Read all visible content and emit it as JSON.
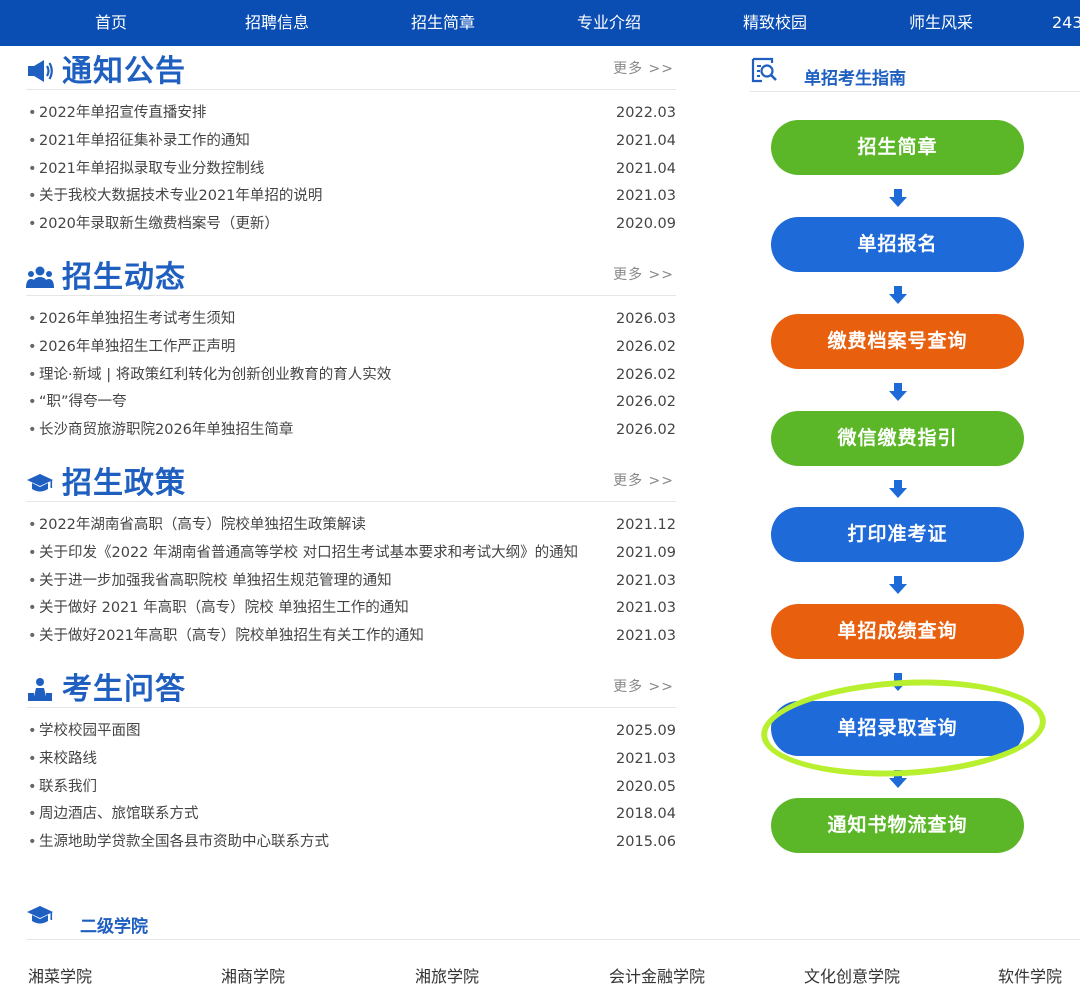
{
  "nav": [
    "首页",
    "招聘信息",
    "招生简章",
    "专业介绍",
    "精致校园",
    "师生风采",
    "243"
  ],
  "sections": [
    {
      "title": "通知公告",
      "more": "更多 >>",
      "items": [
        {
          "title": "2022年单招宣传直播安排",
          "date": "2022.03"
        },
        {
          "title": "2021年单招征集补录工作的通知",
          "date": "2021.04"
        },
        {
          "title": "2021年单招拟录取专业分数控制线",
          "date": "2021.04"
        },
        {
          "title": "关于我校大数据技术专业2021年单招的说明",
          "date": "2021.03"
        },
        {
          "title": "2020年录取新生缴费档案号（更新）",
          "date": "2020.09"
        }
      ]
    },
    {
      "title": "招生动态",
      "more": "更多 >>",
      "items": [
        {
          "title": "2026年单独招生考试考生须知",
          "date": "2026.03"
        },
        {
          "title": "2026年单独招生工作严正声明",
          "date": "2026.02"
        },
        {
          "title": "理论·新域 | 将政策红利转化为创新创业教育的育人实效",
          "date": "2026.02"
        },
        {
          "title": "“职”得夸一夸",
          "date": "2026.02"
        },
        {
          "title": "长沙商贸旅游职院2026年单独招生简章",
          "date": "2026.02"
        }
      ]
    },
    {
      "title": "招生政策",
      "more": "更多 >>",
      "items": [
        {
          "title": "2022年湖南省高职（高专）院校单独招生政策解读",
          "date": "2021.12"
        },
        {
          "title": "关于印发《2022 年湖南省普通高等学校 对口招生考试基本要求和考试大纲》的通知",
          "date": "2021.09"
        },
        {
          "title": "关于进一步加强我省高职院校 单独招生规范管理的通知",
          "date": "2021.03"
        },
        {
          "title": "关于做好 2021 年高职（高专）院校 单独招生工作的通知",
          "date": "2021.03"
        },
        {
          "title": "关于做好2021年高职（高专）院校单独招生有关工作的通知",
          "date": "2021.03"
        }
      ]
    },
    {
      "title": "考生问答",
      "more": "更多 >>",
      "items": [
        {
          "title": "学校校园平面图",
          "date": "2025.09"
        },
        {
          "title": "来校路线",
          "date": "2021.03"
        },
        {
          "title": "联系我们",
          "date": "2020.05"
        },
        {
          "title": "周边酒店、旅馆联系方式",
          "date": "2018.04"
        },
        {
          "title": "生源地助学贷款全国各县市资助中心联系方式",
          "date": "2015.06"
        }
      ]
    }
  ],
  "guide": {
    "title": "单招考生指南",
    "steps": [
      {
        "label": "招生简章",
        "color": "green"
      },
      {
        "label": "单招报名",
        "color": "blue"
      },
      {
        "label": "缴费档案号查询",
        "color": "orange"
      },
      {
        "label": "微信缴费指引",
        "color": "green"
      },
      {
        "label": "打印准考证",
        "color": "blue"
      },
      {
        "label": "单招成绩查询",
        "color": "orange"
      },
      {
        "label": "单招录取查询",
        "color": "blue"
      },
      {
        "label": "通知书物流查询",
        "color": "green"
      }
    ]
  },
  "colleges": {
    "title": "二级学院",
    "items": [
      "湘菜学院",
      "湘商学院",
      "湘旅学院",
      "会计金融学院",
      "文化创意学院",
      "软件学院"
    ]
  },
  "colors": {
    "nav": "#0b4eb3",
    "title": "#1e5fc0",
    "green": "#5bb728",
    "blue": "#1e6ad8",
    "orange": "#e8600e",
    "highlight": "#b8f030"
  }
}
